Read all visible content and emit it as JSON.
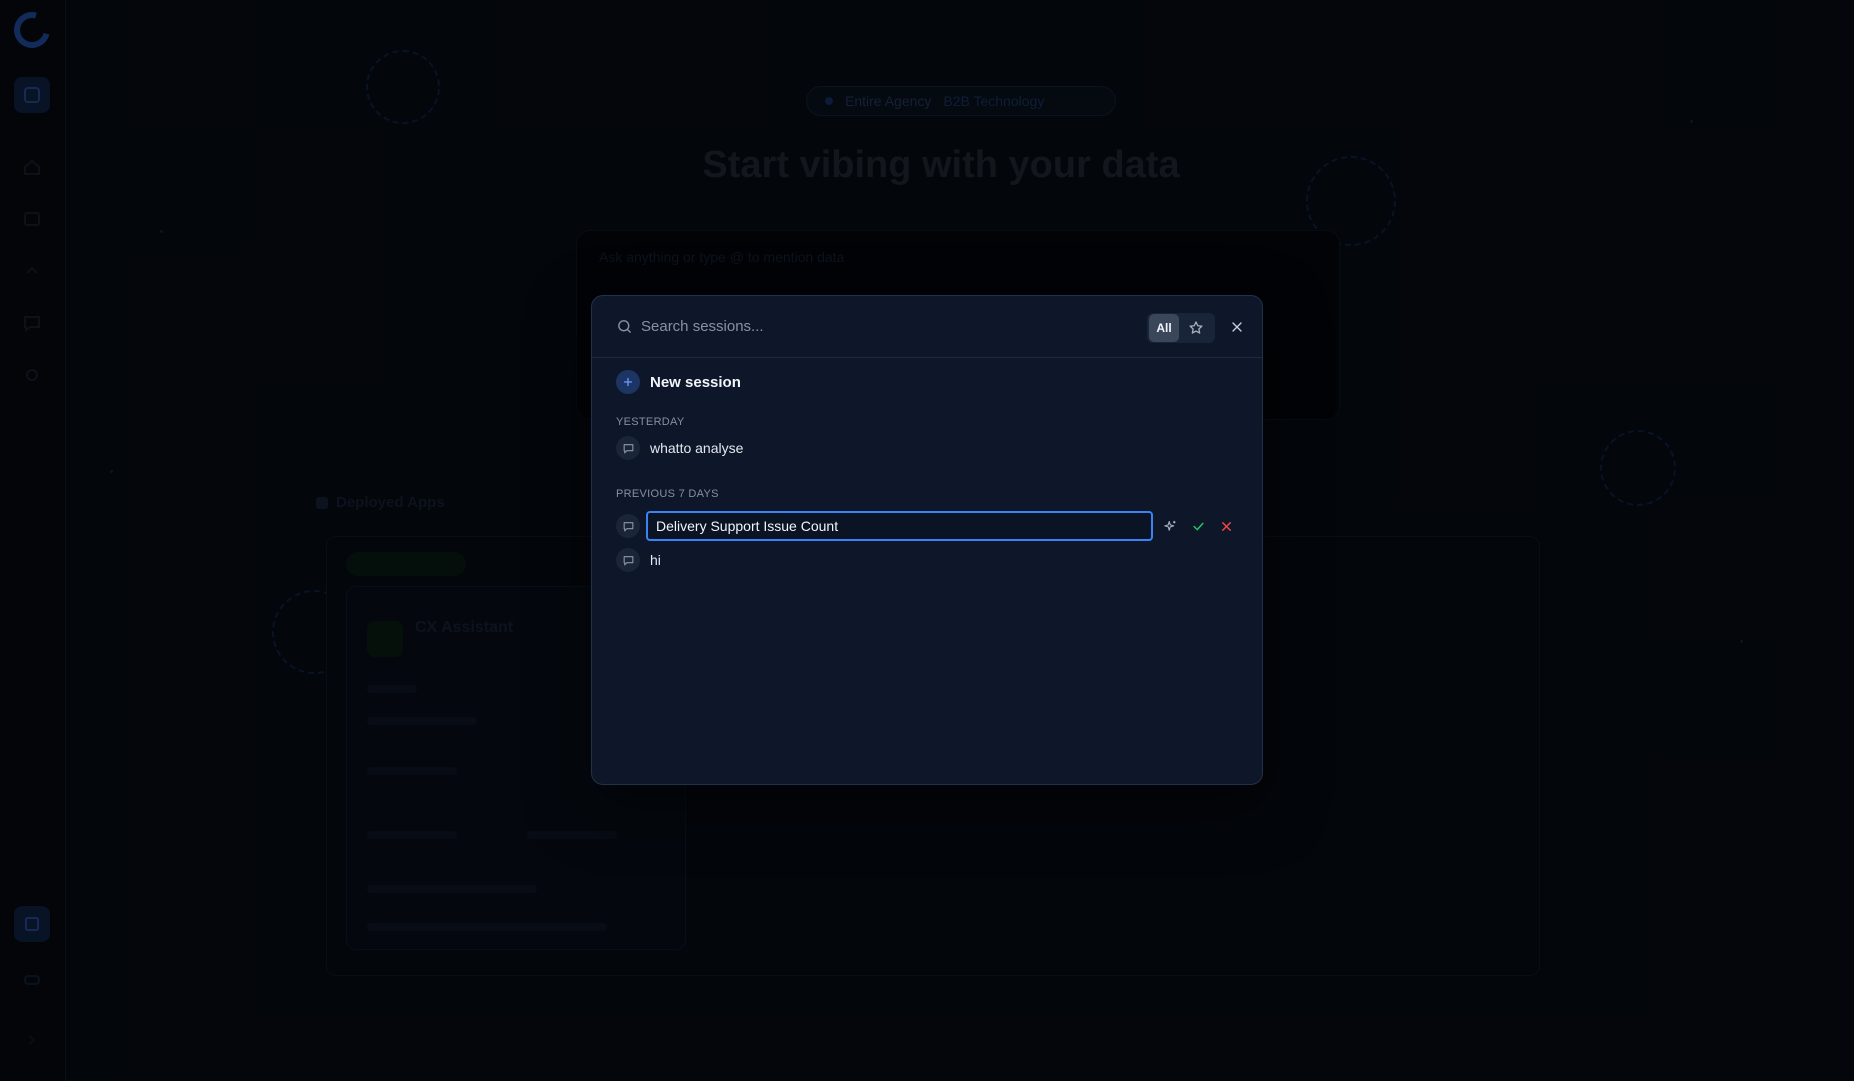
{
  "background": {
    "chip_primary": "Entire Agency",
    "chip_secondary": "B2B Technology",
    "title": "Start vibing with your data",
    "composer_placeholder": "Ask anything or type @ to mention data",
    "panel_title": "Deployed Apps",
    "card_title": "CX Assistant"
  },
  "session_dialog": {
    "search": {
      "placeholder": "Search sessions...",
      "value": ""
    },
    "filters": {
      "all_label": "All",
      "starred_icon": "star-icon",
      "active": "All"
    },
    "close_icon": "close-icon",
    "new_session_label": "New session",
    "groups": [
      {
        "label": "YESTERDAY",
        "items": [
          {
            "title": "whatto analyse"
          }
        ]
      },
      {
        "label": "PREVIOUS 7 DAYS",
        "items": [
          {
            "title": "Delivery Support Issue Count",
            "editing": true
          },
          {
            "title": "hi"
          }
        ]
      }
    ],
    "rename_actions": [
      "sparkles-icon",
      "check-icon",
      "x-icon"
    ]
  },
  "colors": {
    "accent": "#3b82f6",
    "confirm": "#22c55e",
    "cancel": "#ef4444",
    "modal_bg": "#0d1729"
  }
}
